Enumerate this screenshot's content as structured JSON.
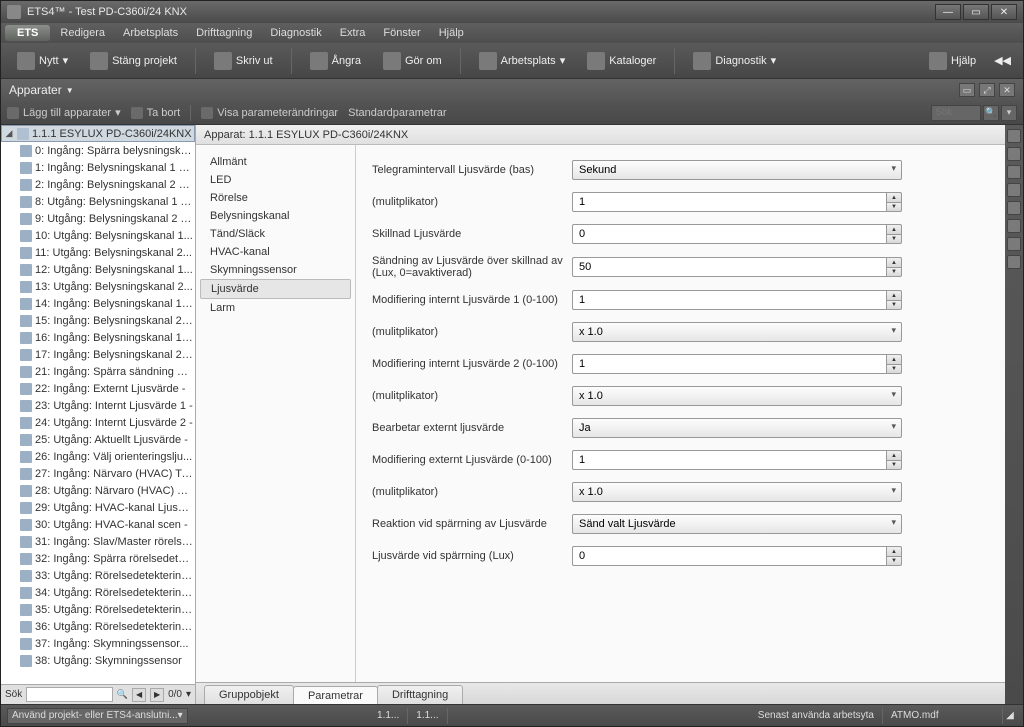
{
  "title": "ETS4™ - Test PD-C360i/24 KNX",
  "menubar": [
    "ETS",
    "Redigera",
    "Arbetsplats",
    "Drifttagning",
    "Diagnostik",
    "Extra",
    "Fönster",
    "Hjälp"
  ],
  "toolbar": {
    "nytt": "Nytt",
    "stang": "Stäng projekt",
    "skriv": "Skriv ut",
    "angra": "Ångra",
    "gorom": "Gör om",
    "arbetsplats": "Arbetsplats",
    "kataloger": "Kataloger",
    "diagnostik": "Diagnostik",
    "hjalp": "Hjälp"
  },
  "panel_title": "Apparater",
  "subtoolbar": {
    "lagg": "Lägg till apparater",
    "tabort": "Ta bort",
    "visa": "Visa parameterändringar",
    "standard": "Standardparametrar",
    "search_placeholder": "Sök"
  },
  "tree_root": "1.1.1 ESYLUX PD-C360i/24KNX",
  "tree_items": [
    "0: Ingång: Spärra belysningska...",
    "1: Ingång: Belysningskanal 1 m...",
    "2: Ingång: Belysningskanal 2 m...",
    "8: Utgång: Belysningskanal 1 T...",
    "9: Utgång: Belysningskanal 2 T...",
    "10: Utgång: Belysningskanal 1...",
    "11: Utgång: Belysningskanal 2...",
    "12: Utgång: Belysningskanal 1...",
    "13: Utgång: Belysningskanal 2...",
    "14: Ingång: Belysningskanal 1 T...",
    "15: Ingång: Belysningskanal 2 T...",
    "16: Ingång: Belysningskanal 1 a...",
    "17: Ingång: Belysningskanal 2 a...",
    "21: Ingång: Spärra sändning av...",
    "22: Ingång: Externt Ljusvärde -",
    "23: Utgång: Internt Ljusvärde 1 -",
    "24: Utgång: Internt Ljusvärde 2 -",
    "25: Utgång: Aktuellt Ljusvärde -",
    "26: Ingång: Välj orienteringslju...",
    "27: Ingång: Närvaro (HVAC) Till...",
    "28: Utgång: Närvaro (HVAC) Till...",
    "29: Utgång: HVAC-kanal Ljusvä...",
    "30: Utgång: HVAC-kanal scen -",
    "31: Ingång: Slav/Master rörelse -",
    "32: Ingång: Spärra rörelsedetek...",
    "33: Utgång: Rörelsedetektering...",
    "34: Utgång: Rörelsedetektering...",
    "35: Utgång: Rörelsedetektering...",
    "36: Utgång: Rörelsedetektering...",
    "37: Ingång: Skymningssensor...",
    "38: Utgång: Skymningssensor"
  ],
  "bottom_search": {
    "label": "Sök",
    "count": "0/0"
  },
  "apparat_header": "Apparat: 1.1.1  ESYLUX PD-C360i/24KNX",
  "param_nav": [
    "Allmänt",
    "LED",
    "Rörelse",
    "Belysningskanal",
    "Tänd/Släck",
    "HVAC-kanal",
    "Skymningssensor",
    "Ljusvärde",
    "Larm"
  ],
  "param_nav_selected": 7,
  "form": {
    "rows": [
      {
        "label": "Telegramintervall Ljusvärde (bas)",
        "type": "select",
        "value": "Sekund"
      },
      {
        "label": "  (mulitplikator)",
        "type": "spinner",
        "value": "1"
      },
      {
        "label": "Skillnad Ljusvärde",
        "type": "spinner",
        "value": "0"
      },
      {
        "label": "Sändning av Ljusvärde över skillnad av (Lux, 0=avaktiverad)",
        "type": "spinner",
        "value": "50"
      },
      {
        "label": "Modifiering internt Ljusvärde 1 (0-100)",
        "type": "spinner",
        "value": "1"
      },
      {
        "label": "  (mulitplikator)",
        "type": "select",
        "value": "x 1.0"
      },
      {
        "label": "Modifiering internt Ljusvärde 2 (0-100)",
        "type": "spinner",
        "value": "1"
      },
      {
        "label": "  (mulitplikator)",
        "type": "select",
        "value": "x 1.0"
      },
      {
        "label": "Bearbetar externt ljusvärde",
        "type": "select",
        "value": "Ja"
      },
      {
        "label": "Modifiering externt Ljusvärde (0-100)",
        "type": "spinner",
        "value": "1"
      },
      {
        "label": "  (mulitplikator)",
        "type": "select",
        "value": "x 1.0"
      },
      {
        "label": "Reaktion vid spärrning av Ljusvärde",
        "type": "select",
        "value": "Sänd valt Ljusvärde"
      },
      {
        "label": "Ljusvärde vid spärrning (Lux)",
        "type": "spinner",
        "value": "0"
      }
    ]
  },
  "bottom_tabs": [
    "Gruppobjekt",
    "Parametrar",
    "Drifttagning"
  ],
  "bottom_tab_active": 1,
  "statusbar": {
    "left_dropdown": "Använd projekt- eller ETS4-anslutni...",
    "c1": "1.1...",
    "c2": "1.1...",
    "senast": "Senast använda arbetsyta",
    "file": "ATMO.mdf"
  }
}
